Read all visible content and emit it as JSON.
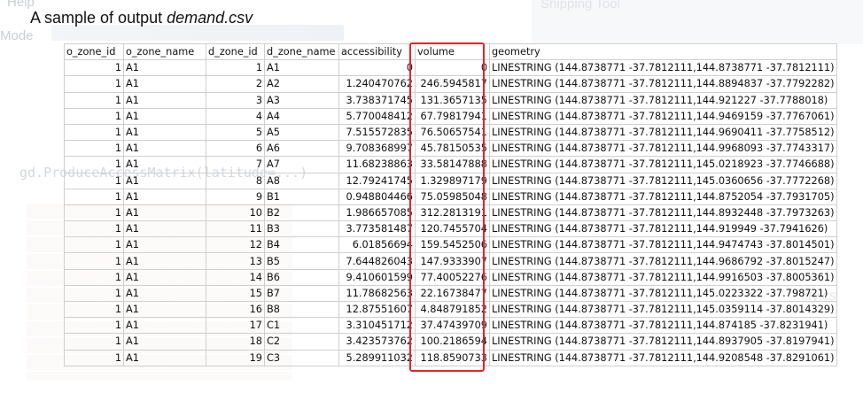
{
  "background": {
    "menu_help": "Help",
    "mode_label": "Mode",
    "shipping_tool": "Shipping Tool",
    "code_snippet": "gd.ProduceAccessMatrix(latitude=...)",
    "tail_text": "lity.cs"
  },
  "title": {
    "prefix": "A sample of output ",
    "filename": "demand.csv"
  },
  "colors": {
    "highlight": "#e0262a",
    "grid": "#cfcfcf"
  },
  "table": {
    "columns": [
      "o_zone_id",
      "o_zone_name",
      "d_zone_id",
      "d_zone_name",
      "accessibility",
      "volume",
      "geometry"
    ],
    "rows": [
      [
        "1",
        "A1",
        "1",
        "A1",
        "0",
        "0",
        "LINESTRING (144.8738771 -37.7812111,144.8738771 -37.7812111)"
      ],
      [
        "1",
        "A1",
        "2",
        "A2",
        "1.240470762",
        "246.5945817",
        "LINESTRING (144.8738771 -37.7812111,144.8894837 -37.7792282)"
      ],
      [
        "1",
        "A1",
        "3",
        "A3",
        "3.738371745",
        "131.3657135",
        "LINESTRING (144.8738771 -37.7812111,144.921227 -37.7788018)"
      ],
      [
        "1",
        "A1",
        "4",
        "A4",
        "5.770048412",
        "67.79817941",
        "LINESTRING (144.8738771 -37.7812111,144.9469159 -37.7767061)"
      ],
      [
        "1",
        "A1",
        "5",
        "A5",
        "7.515572835",
        "76.50657541",
        "LINESTRING (144.8738771 -37.7812111,144.9690411 -37.7758512)"
      ],
      [
        "1",
        "A1",
        "6",
        "A6",
        "9.708368997",
        "45.78150535",
        "LINESTRING (144.8738771 -37.7812111,144.9968093 -37.7743317)"
      ],
      [
        "1",
        "A1",
        "7",
        "A7",
        "11.68238863",
        "33.58147888",
        "LINESTRING (144.8738771 -37.7812111,145.0218923 -37.7746688)"
      ],
      [
        "1",
        "A1",
        "8",
        "A8",
        "12.79241745",
        "1.329897179",
        "LINESTRING (144.8738771 -37.7812111,145.0360656 -37.7772268)"
      ],
      [
        "1",
        "A1",
        "9",
        "B1",
        "0.948804466",
        "75.05985048",
        "LINESTRING (144.8738771 -37.7812111,144.8752054 -37.7931705)"
      ],
      [
        "1",
        "A1",
        "10",
        "B2",
        "1.986657085",
        "312.2813191",
        "LINESTRING (144.8738771 -37.7812111,144.8932448 -37.7973263)"
      ],
      [
        "1",
        "A1",
        "11",
        "B3",
        "3.773581487",
        "120.7455704",
        "LINESTRING (144.8738771 -37.7812111,144.919949 -37.7941626)"
      ],
      [
        "1",
        "A1",
        "12",
        "B4",
        "6.01856694",
        "159.5452506",
        "LINESTRING (144.8738771 -37.7812111,144.9474743 -37.8014501)"
      ],
      [
        "1",
        "A1",
        "13",
        "B5",
        "7.644826043",
        "147.9333907",
        "LINESTRING (144.8738771 -37.7812111,144.9686792 -37.8015247)"
      ],
      [
        "1",
        "A1",
        "14",
        "B6",
        "9.410601599",
        "77.40052276",
        "LINESTRING (144.8738771 -37.7812111,144.9916503 -37.8005361)"
      ],
      [
        "1",
        "A1",
        "15",
        "B7",
        "11.78682563",
        "22.16738477",
        "LINESTRING (144.8738771 -37.7812111,145.0223322 -37.798721)"
      ],
      [
        "1",
        "A1",
        "16",
        "B8",
        "12.87551607",
        "4.848791852",
        "LINESTRING (144.8738771 -37.7812111,145.0359114 -37.8014329)"
      ],
      [
        "1",
        "A1",
        "17",
        "C1",
        "3.310451712",
        "37.47439709",
        "LINESTRING (144.8738771 -37.7812111,144.874185 -37.8231941)"
      ],
      [
        "1",
        "A1",
        "18",
        "C2",
        "3.423573762",
        "100.2186594",
        "LINESTRING (144.8738771 -37.7812111,144.8937905 -37.8197941)"
      ],
      [
        "1",
        "A1",
        "19",
        "C3",
        "5.289911032",
        "118.8590733",
        "LINESTRING (144.8738771 -37.7812111,144.9208548 -37.8291061)"
      ]
    ]
  }
}
